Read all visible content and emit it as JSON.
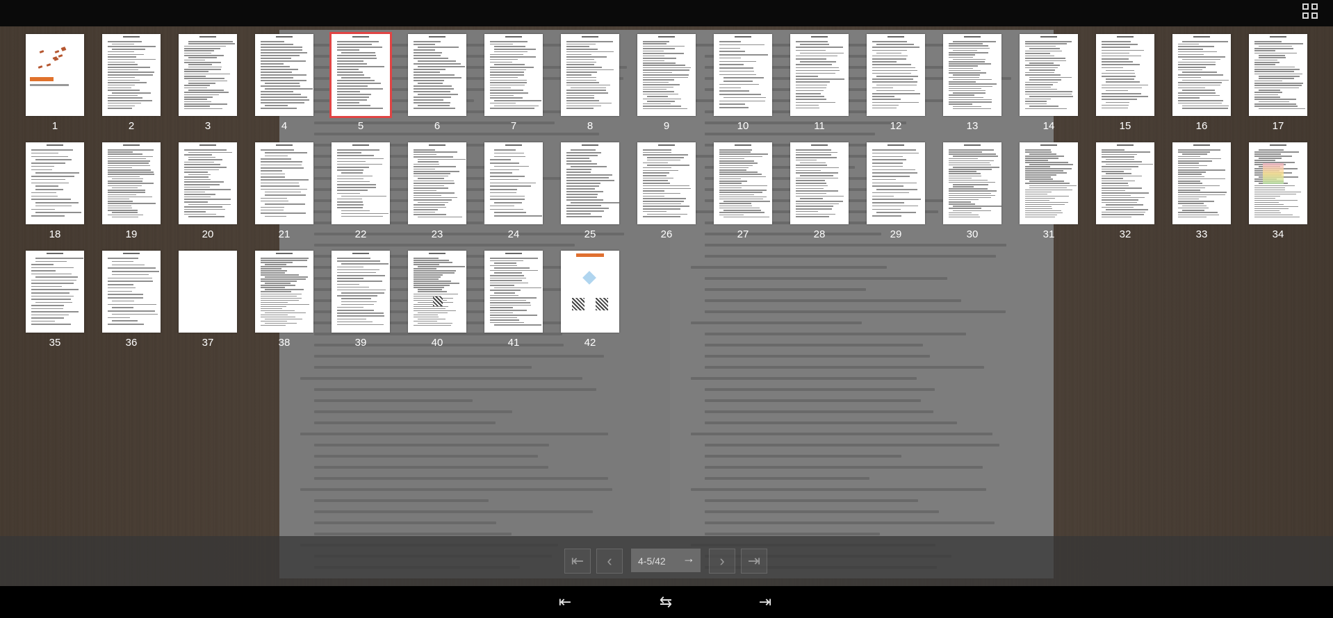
{
  "toolbar": {
    "grid_icon": "thumbnail-grid-icon"
  },
  "thumbnails": {
    "active_page": 5,
    "pages": [
      "1",
      "2",
      "3",
      "4",
      "5",
      "6",
      "7",
      "8",
      "9",
      "10",
      "11",
      "12",
      "13",
      "14",
      "15",
      "16",
      "17",
      "18",
      "19",
      "20",
      "21",
      "22",
      "23",
      "24",
      "25",
      "26",
      "27",
      "28",
      "29",
      "30",
      "31",
      "32",
      "33",
      "34",
      "35",
      "36",
      "37",
      "38",
      "39",
      "40",
      "41",
      "42"
    ]
  },
  "navigation": {
    "first_icon": "first-page-icon",
    "prev_icon": "previous-page-icon",
    "page_value": "4-5/42",
    "go_icon": "go-arrow-icon",
    "next_icon": "next-page-icon",
    "last_icon": "last-page-icon"
  },
  "bottom": {
    "first_icon": "first-page-icon",
    "flip_icon": "flip-mode-icon",
    "last_icon": "last-page-icon"
  },
  "colors": {
    "active_border": "#e04444",
    "wood": "#6b5644"
  }
}
